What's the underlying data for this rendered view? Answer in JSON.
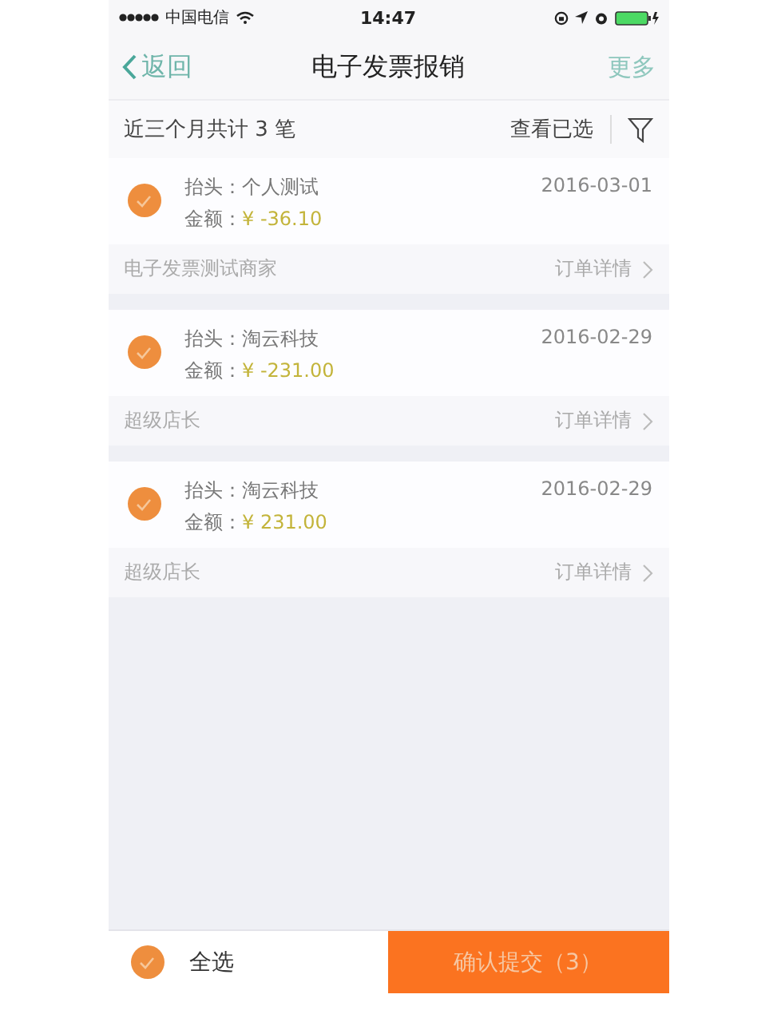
{
  "status_bar": {
    "carrier": "中国电信",
    "time": "14:47"
  },
  "nav": {
    "back": "返回",
    "title": "电子发票报销",
    "more": "更多"
  },
  "filter_bar": {
    "summary": "近三个月共计 3 笔",
    "view_selected": "查看已选"
  },
  "invoices": [
    {
      "checked": true,
      "header_label": "抬头：",
      "header": "个人测试",
      "amount_label": "金额：",
      "amount": "¥ -36.10",
      "date": "2016-03-01",
      "merchant": "电子发票测试商家",
      "details": "订单详情"
    },
    {
      "checked": true,
      "header_label": "抬头：",
      "header": "淘云科技",
      "amount_label": "金额：",
      "amount": "¥ -231.00",
      "date": "2016-02-29",
      "merchant": "超级店长",
      "details": "订单详情"
    },
    {
      "checked": true,
      "header_label": "抬头：",
      "header": "淘云科技",
      "amount_label": "金额：",
      "amount": "¥ 231.00",
      "date": "2016-02-29",
      "merchant": "超级店长",
      "details": "订单详情"
    }
  ],
  "footer": {
    "select_all_checked": true,
    "select_all": "全选",
    "submit": "确认提交（3）"
  }
}
